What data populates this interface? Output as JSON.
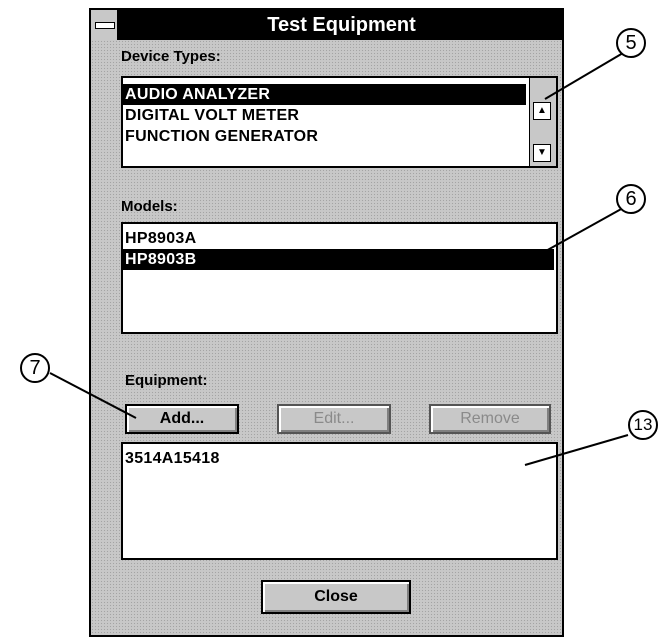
{
  "window": {
    "title": "Test Equipment"
  },
  "device_types": {
    "label": "Device Types:",
    "items": [
      "AUDIO ANALYZER",
      "DIGITAL VOLT METER",
      "FUNCTION GENERATOR"
    ],
    "selected_index": 0,
    "scroll_up_icon": "up-arrow",
    "scroll_down_icon": "down-arrow"
  },
  "models": {
    "label": "Models:",
    "items": [
      "HP8903A",
      "HP8903B"
    ],
    "selected_index": 1
  },
  "equipment": {
    "label": "Equipment:",
    "buttons": {
      "add": "Add...",
      "edit": "Edit...",
      "remove": "Remove"
    },
    "items": [
      "3514A15418"
    ]
  },
  "close_button": "Close",
  "callouts": [
    "5",
    "6",
    "7",
    "13"
  ]
}
